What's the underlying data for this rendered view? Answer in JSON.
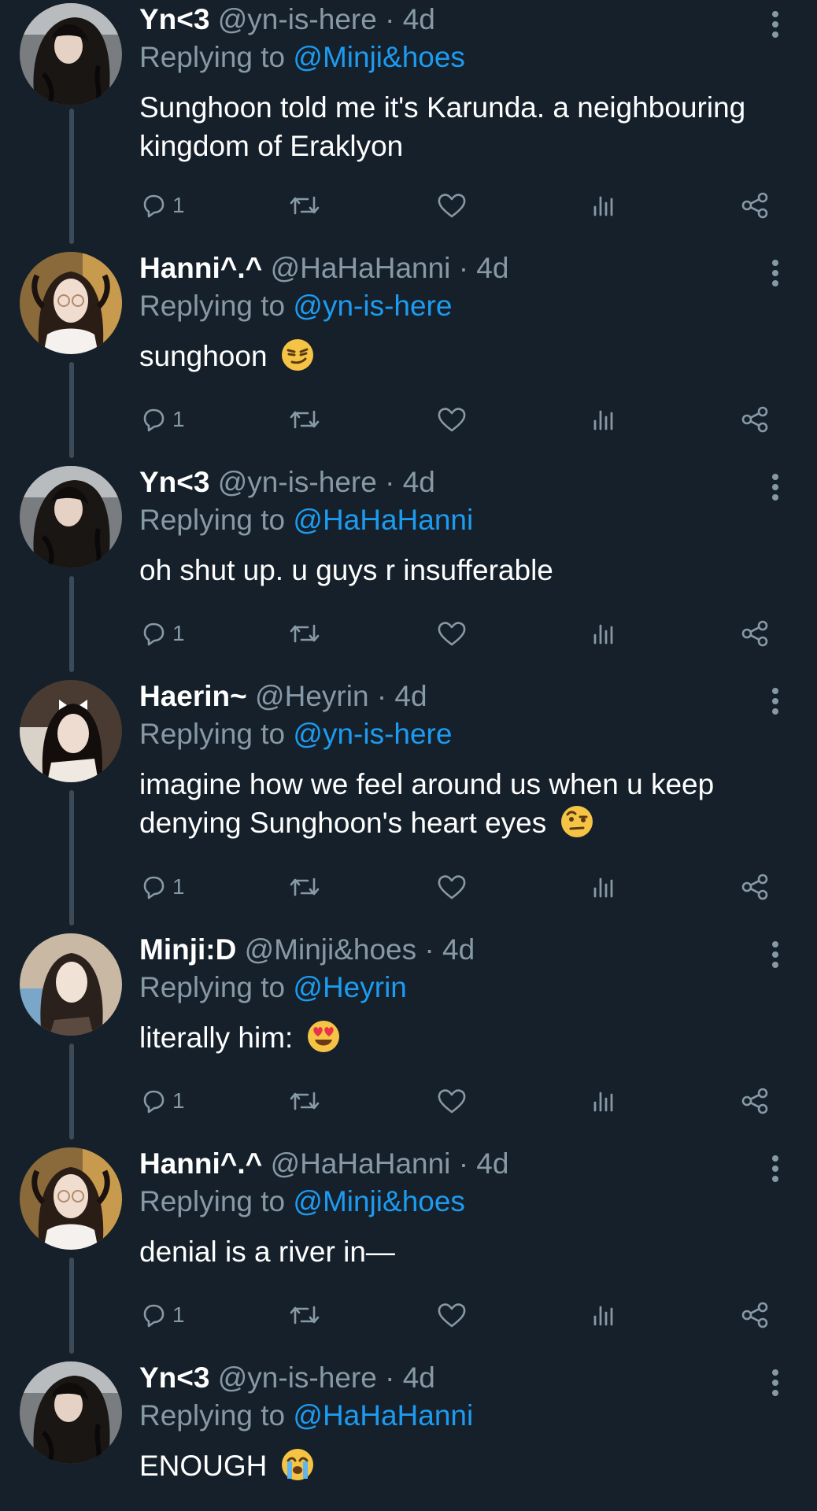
{
  "colors": {
    "background": "#15202b",
    "text": "#ffffff",
    "muted": "#8899a6",
    "link": "#1d9bf0",
    "thread_line": "#3d4a57"
  },
  "reply_prefix": "Replying to",
  "tweets": [
    {
      "name": "Yn<3",
      "handle": "@yn-is-here",
      "separator": "·",
      "time": "4d",
      "reply_to": "@Minji&hoes",
      "text": "Sunghoon told me it's Karunda. a neighbouring kingdom of Eraklyon",
      "emoji": "",
      "reply_count": "1",
      "avatar": "dark-hair-portrait"
    },
    {
      "name": "Hanni^.^",
      "handle": "@HaHaHanni",
      "separator": "·",
      "time": "4d",
      "reply_to": "@yn-is-here",
      "text": "sunghoon",
      "emoji": "smirking-face",
      "reply_count": "1",
      "avatar": "pigtails-glasses-portrait"
    },
    {
      "name": "Yn<3",
      "handle": "@yn-is-here",
      "separator": "·",
      "time": "4d",
      "reply_to": "@HaHaHanni",
      "text": "oh shut up. u guys r insufferable",
      "emoji": "",
      "reply_count": "1",
      "avatar": "dark-hair-portrait"
    },
    {
      "name": "Haerin~",
      "handle": "@Heyrin",
      "separator": "·",
      "time": "4d",
      "reply_to": "@yn-is-here",
      "text": "imagine how we feel around us when u keep denying Sunghoon's heart eyes",
      "emoji": "face-with-raised-eyebrow",
      "reply_count": "1",
      "avatar": "hair-bow-portrait"
    },
    {
      "name": "Minji:D",
      "handle": "@Minji&hoes",
      "separator": "·",
      "time": "4d",
      "reply_to": "@Heyrin",
      "text": "literally him:",
      "emoji": "heart-eyes",
      "reply_count": "1",
      "avatar": "long-hair-portrait"
    },
    {
      "name": "Hanni^.^",
      "handle": "@HaHaHanni",
      "separator": "·",
      "time": "4d",
      "reply_to": "@Minji&hoes",
      "text": "denial is a river in—",
      "emoji": "",
      "reply_count": "1",
      "avatar": "pigtails-glasses-portrait"
    },
    {
      "name": "Yn<3",
      "handle": "@yn-is-here",
      "separator": "·",
      "time": "4d",
      "reply_to": "@HaHaHanni",
      "text": "ENOUGH",
      "emoji": "loudly-crying-face",
      "reply_count": "",
      "avatar": "dark-hair-portrait"
    }
  ],
  "icons": [
    "reply-icon",
    "retweet-icon",
    "like-icon",
    "analytics-icon",
    "share-icon",
    "more-icon"
  ]
}
